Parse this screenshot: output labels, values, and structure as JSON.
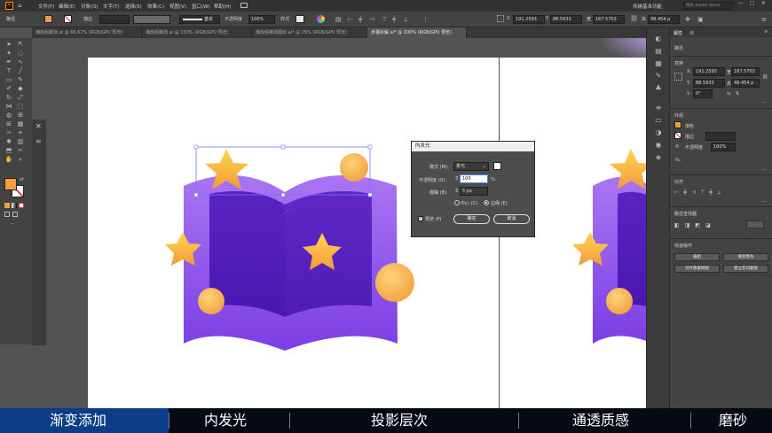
{
  "menubar": {
    "items": [
      "文件(F)",
      "编辑(E)",
      "对象(O)",
      "文字(T)",
      "选择(S)",
      "效果(C)",
      "视图(V)",
      "窗口(W)",
      "帮助(H)"
    ],
    "workspace": "传统基本功能",
    "search_placeholder": "搜索 Adobe Stock"
  },
  "control_bar": {
    "path_label": "路径",
    "stroke_label": "描边",
    "stroke_style": "基本",
    "opacity_label": "不透明度",
    "opacity_value": "100%",
    "style_label": "样式",
    "x_label": "X",
    "x_value": "191.2593",
    "y_label": "Y",
    "y_value": "88.5933",
    "w_label": "宽",
    "w_value": "167.5703",
    "h_label": "高",
    "h_value": "48.454 p"
  },
  "tabs": [
    "播放组推测.ai @ 66.67% (RGB/GPU 预览)",
    "播放组推测.ai @ 150% (RGB/GPU 预览)",
    "播放组推测图标.ai* @ 25% (RGB/GPU 预览)",
    "步骤拆解.ai* @ 200% (RGB/GPU 预览)"
  ],
  "dialog": {
    "title": "内发光",
    "mode_label": "模式 (M):",
    "mode_value": "柔光",
    "opacity_label": "不透明度 (O):",
    "opacity_value": "100",
    "opacity_unit": "%",
    "blur_label": "模糊 (B):",
    "blur_value": "5 px",
    "center_label": "中心 (C)",
    "edge_label": "边缘 (E)",
    "preview_label": "预览 (P)",
    "ok_label": "确定",
    "cancel_label": "取消",
    "glow_color": "#ffffff"
  },
  "properties_panel": {
    "tab_properties": "属性",
    "tab_libraries": "库",
    "path_heading": "路径",
    "transform_heading": "变换",
    "x_label": "X:",
    "x_value": "191.2593",
    "y_label": "Y:",
    "y_value": "88.5933",
    "w_label": "宽:",
    "w_value": "167.5703",
    "h_label": "高:",
    "h_value": "48.454 p",
    "angle_value": "0°",
    "appearance_heading": "外观",
    "fill_label": "填色",
    "stroke_label": "描边",
    "opacity_label": "不透明度",
    "opacity_value": "100%",
    "fx_label": "fx.",
    "align_heading": "对齐",
    "pathfinder_heading": "路径查找器",
    "quick_actions_heading": "快速操作",
    "btn_edit": "编组",
    "btn_recolor": "重新着色",
    "btn_align_pixel": "对齐像素网格",
    "btn_clip_mask": "建立剪切蒙版",
    "fill_color": "#f0a040"
  },
  "subtitles": {
    "items": [
      "渐变添加",
      "内发光",
      "投影层次",
      "通透质感",
      "磨砂"
    ],
    "highlight_color": "#0b3e86"
  },
  "colors": {
    "book_purple_top": "#a975f2",
    "book_purple_bottom": "#7b3fe4",
    "book_inner": "#5a22c4",
    "gold_light": "#ffd64f",
    "gold_dark": "#f39a3c"
  }
}
